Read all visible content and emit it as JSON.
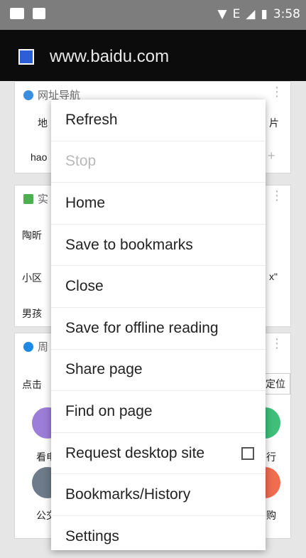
{
  "status_bar": {
    "time": "3:58",
    "network_label": "E"
  },
  "toolbar": {
    "url": "www.baidu.com"
  },
  "cards": {
    "nav_title": "网址导航",
    "nav_left_1": "地",
    "nav_right_1": "片",
    "nav_left_2": "hao",
    "news_title": "实",
    "news_left_1": "陶昕",
    "news_left_2": "小区",
    "news_right_2": "x\"",
    "news_left_3": "男孩",
    "loc_title": "周",
    "loc_left": "点击",
    "loc_right": "定位",
    "icon_left_1": "看电",
    "icon_right_1": "行",
    "icon_left_2": "公交",
    "icon_right_2": "购"
  },
  "menu": {
    "items": [
      {
        "label": "Refresh",
        "disabled": false
      },
      {
        "label": "Stop",
        "disabled": true
      },
      {
        "label": "Home",
        "disabled": false
      },
      {
        "label": "Save to bookmarks",
        "disabled": false
      },
      {
        "label": "Close",
        "disabled": false
      },
      {
        "label": "Save for offline reading",
        "disabled": false
      },
      {
        "label": "Share page",
        "disabled": false
      },
      {
        "label": "Find on page",
        "disabled": false
      },
      {
        "label": "Request desktop site",
        "disabled": false,
        "checked": false
      },
      {
        "label": "Bookmarks/History",
        "disabled": false
      },
      {
        "label": "Settings",
        "disabled": false
      }
    ]
  }
}
